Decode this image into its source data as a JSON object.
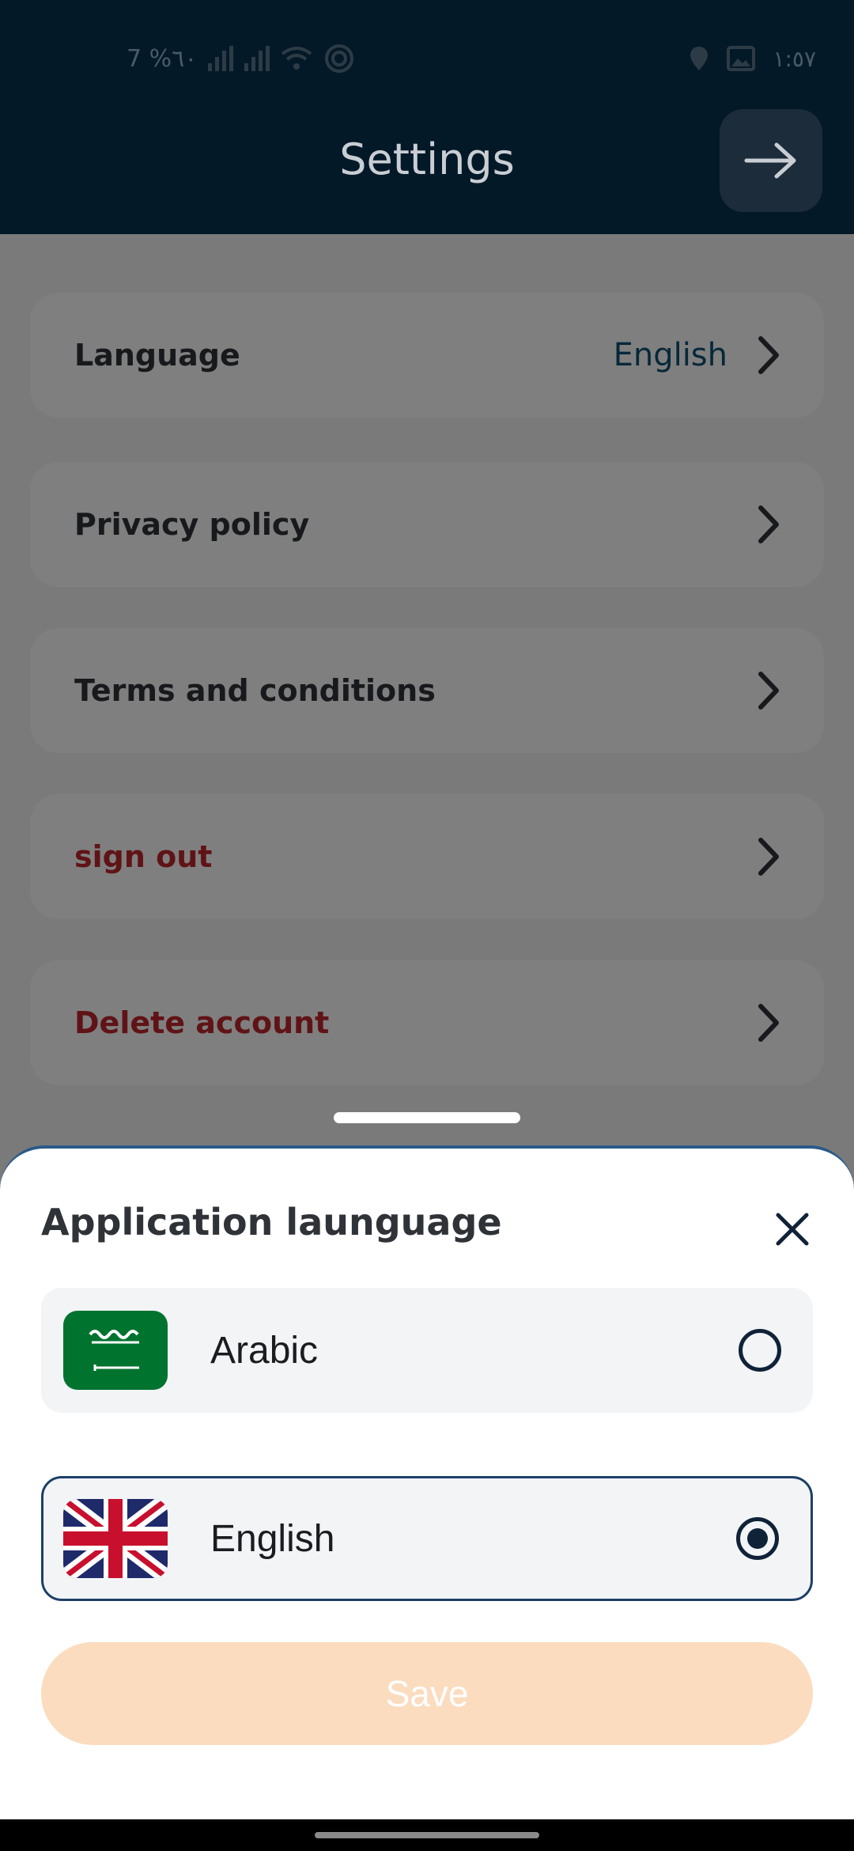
{
  "status_bar": {
    "left_text": "7 %٦٠",
    "right_text": "١:٥٧"
  },
  "header": {
    "title": "Settings",
    "back_icon": "arrow-right-icon"
  },
  "settings": {
    "items": [
      {
        "label": "Language",
        "value": "English",
        "style": "normal"
      },
      {
        "label": "Privacy policy",
        "value": "",
        "style": "normal"
      },
      {
        "label": "Terms and conditions",
        "value": "",
        "style": "normal"
      },
      {
        "label": "sign out",
        "value": "",
        "style": "danger"
      },
      {
        "label": "Delete account",
        "value": "",
        "style": "danger"
      }
    ]
  },
  "language_sheet": {
    "title": "Application launguage",
    "options": [
      {
        "label": "Arabic",
        "flag": "saudi-flag-icon",
        "selected": false
      },
      {
        "label": "English",
        "flag": "uk-flag-icon",
        "selected": true
      }
    ],
    "save_label": "Save"
  },
  "colors": {
    "header_bg": "#041928",
    "danger": "#c0272d",
    "accent": "#0f5073",
    "save_bg": "#fbdcbf",
    "selected_border": "#1d3f66"
  }
}
